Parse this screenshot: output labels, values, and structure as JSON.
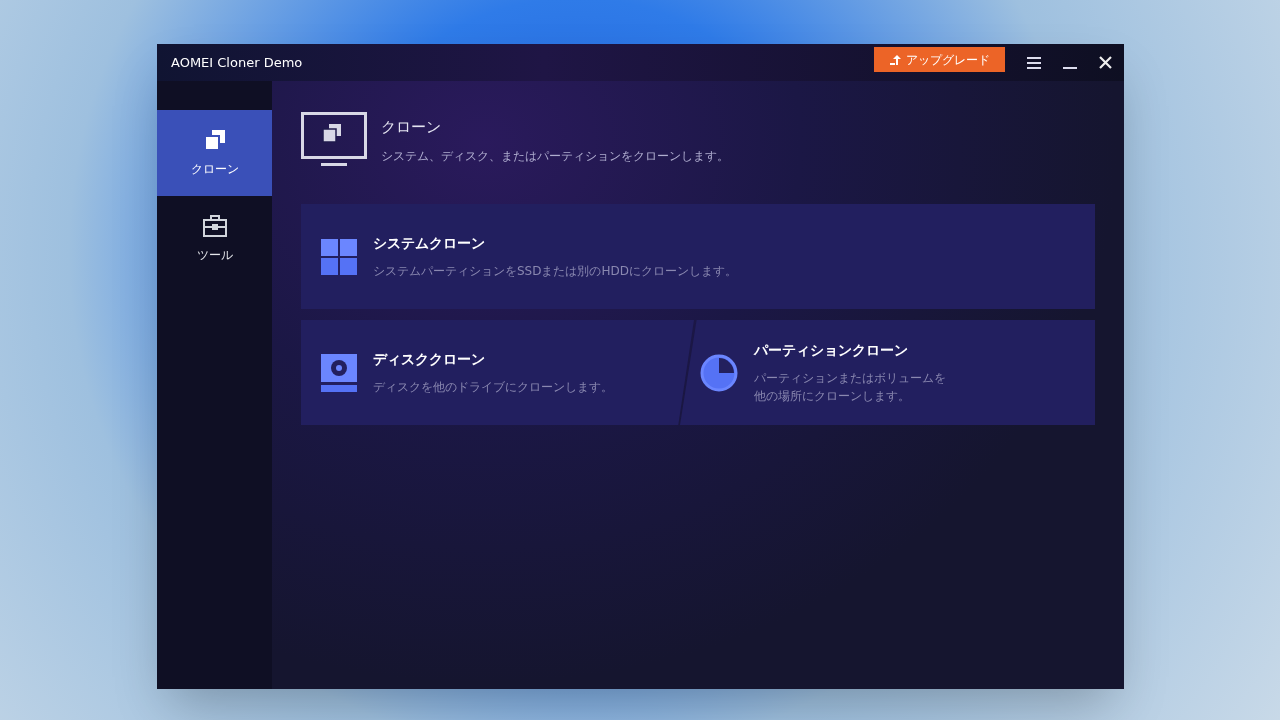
{
  "window": {
    "title": "AOMEI Cloner Demo",
    "upgrade_button": "アップグレード"
  },
  "sidebar": {
    "items": [
      {
        "label": "クローン",
        "kind": "clone",
        "selected": true
      },
      {
        "label": "ツール",
        "kind": "tools",
        "selected": false
      }
    ]
  },
  "header": {
    "title": "クローン",
    "subtitle": "システム、ディスク、またはパーティションをクローンします。"
  },
  "cards": [
    {
      "kind": "system",
      "title": "システムクローン",
      "description": "システムパーティションをSSDまたは別のHDDにクローンします。"
    },
    {
      "kind": "disk",
      "title": "ディスククローン",
      "description": "ディスクを他のドライブにクローンします。"
    },
    {
      "kind": "partition",
      "title": "パーティションクローン",
      "description": "パーティションまたはボリュームを",
      "description_line_2": "他の場所にクローンします。"
    }
  ]
}
